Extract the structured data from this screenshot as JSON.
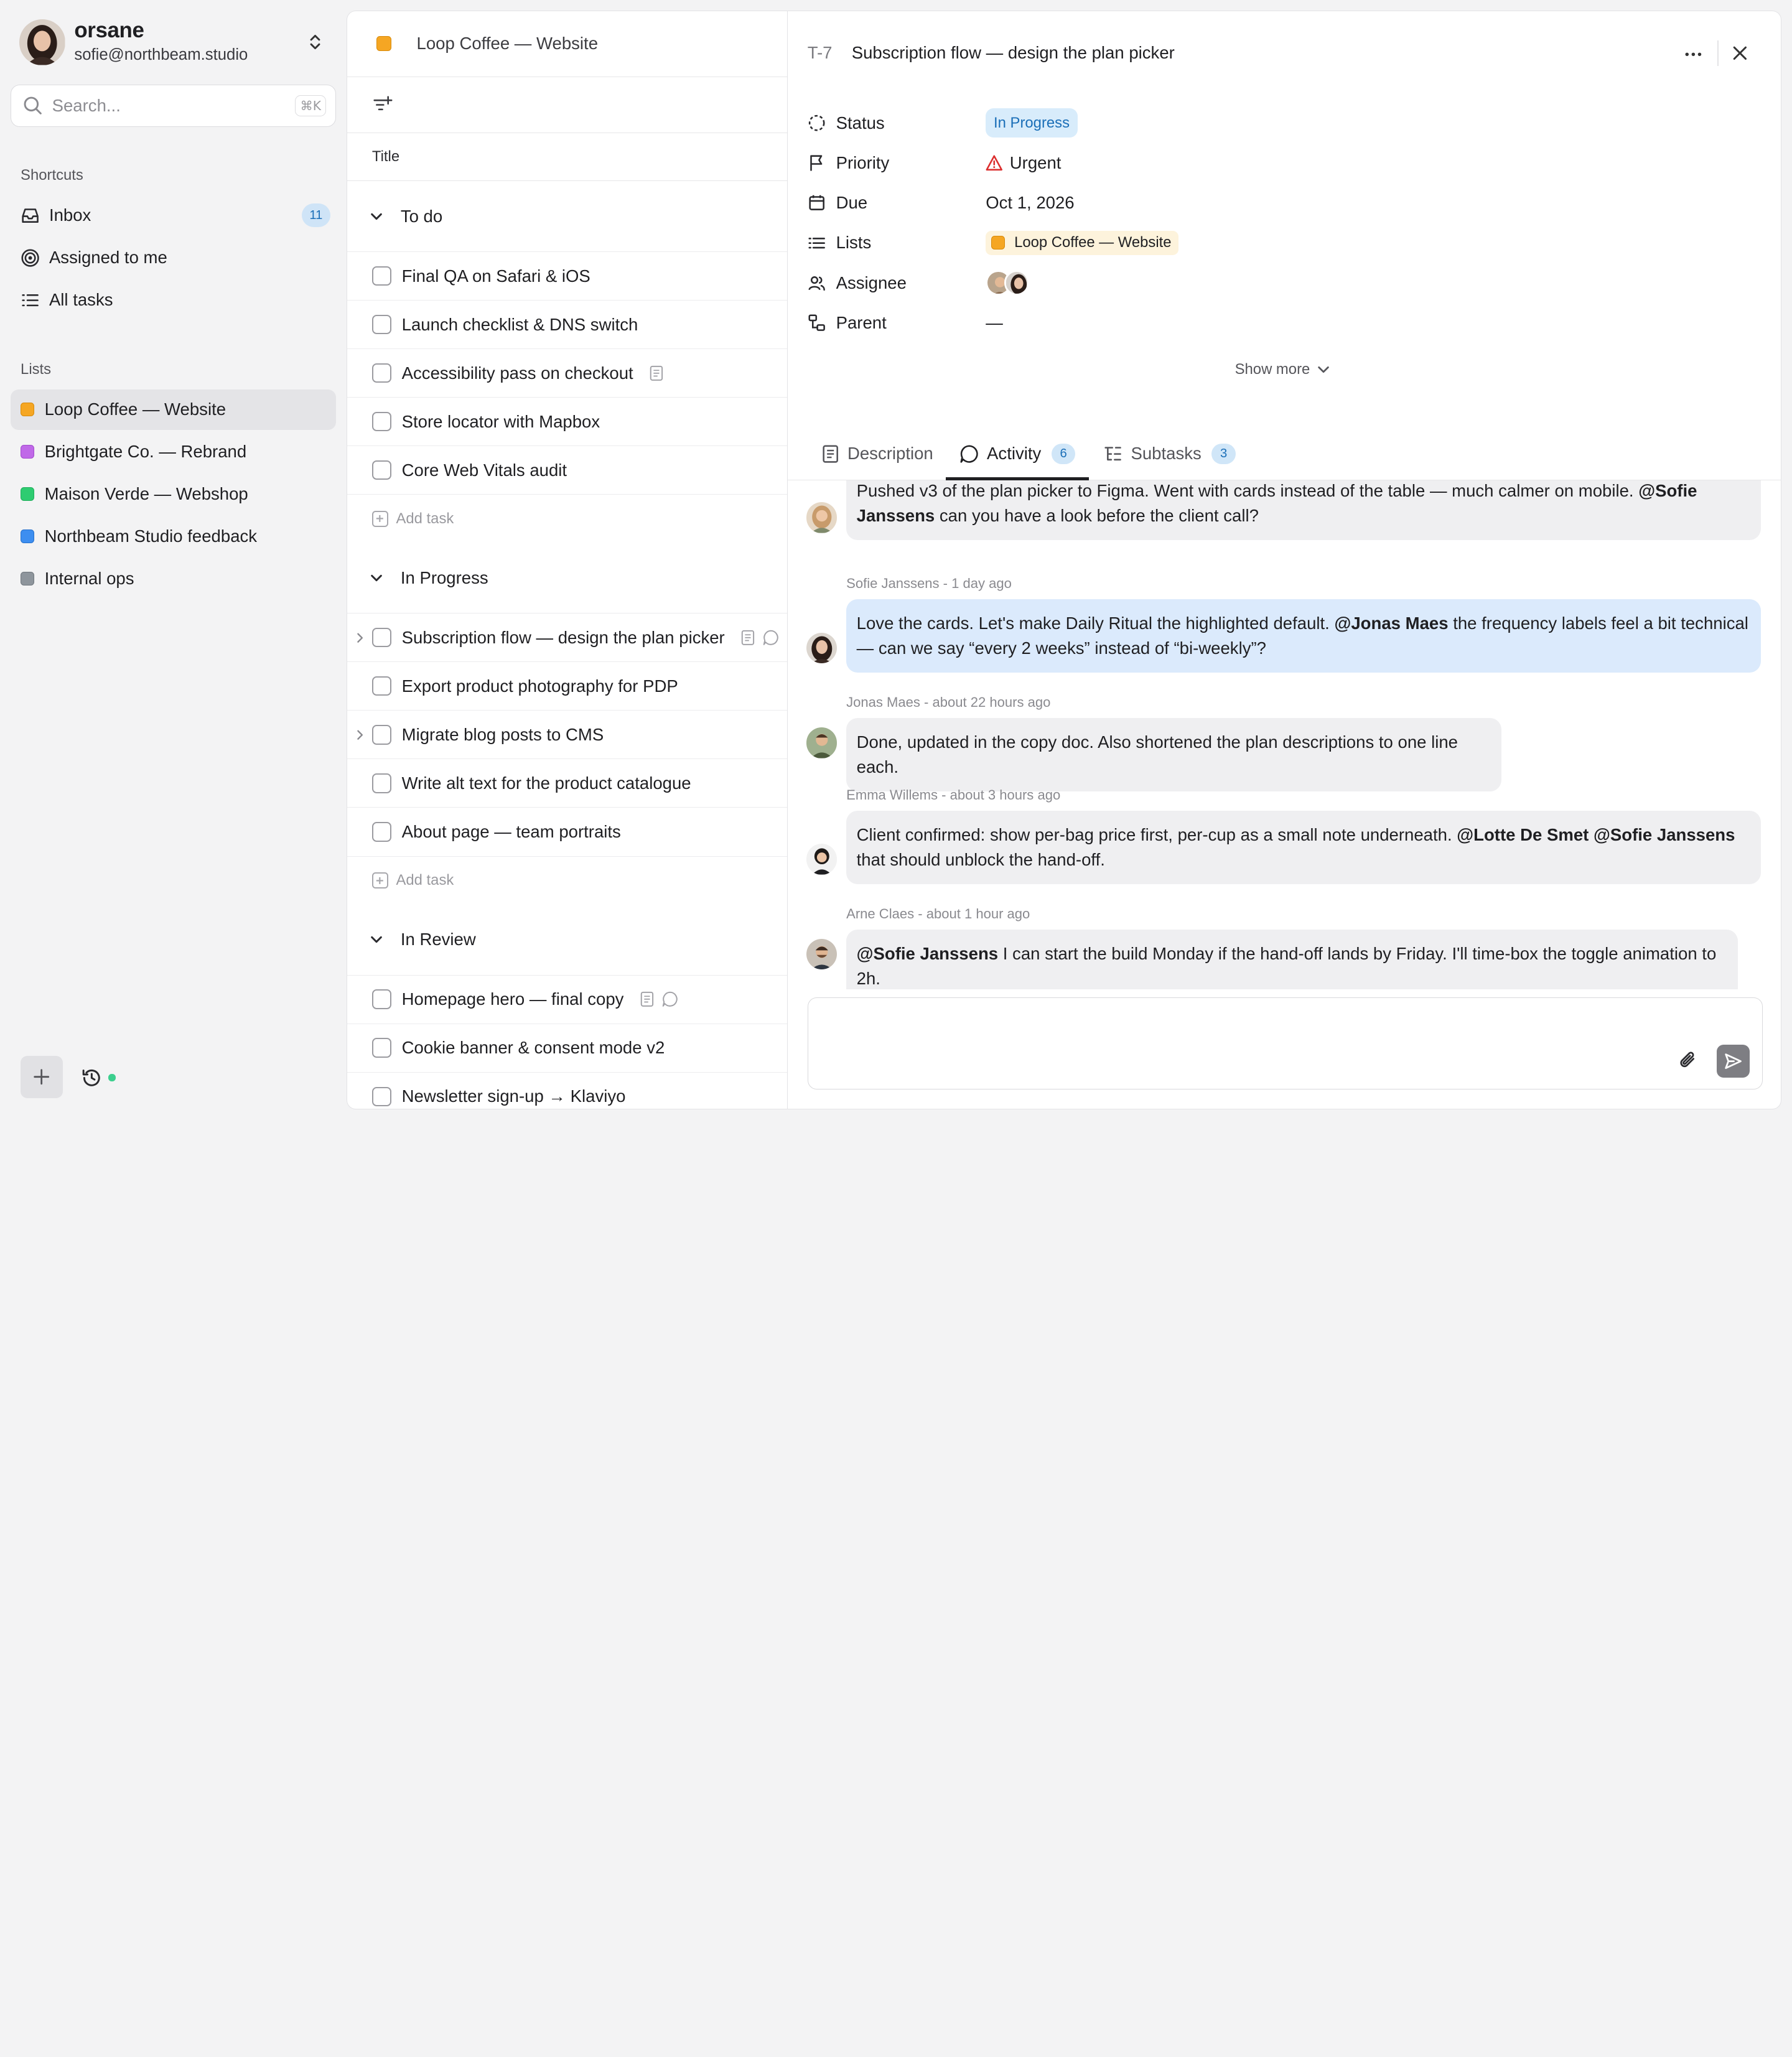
{
  "account": {
    "name": "orsane",
    "email": "sofie@northbeam.studio"
  },
  "search": {
    "placeholder": "Search...",
    "shortcut": "⌘K"
  },
  "shortcuts": {
    "label": "Shortcuts",
    "items": [
      {
        "label": "Inbox",
        "count": "11",
        "icon": "inbox-icon"
      },
      {
        "label": "Assigned to me",
        "icon": "target-icon"
      },
      {
        "label": "All tasks",
        "icon": "list-icon"
      }
    ]
  },
  "lists": {
    "label": "Lists",
    "items": [
      {
        "label": "Loop Coffee — Website",
        "color": "#f5a623",
        "active": true
      },
      {
        "label": "Brightgate Co. — Rebrand",
        "color": "#c069e8"
      },
      {
        "label": "Maison Verde — Webshop",
        "color": "#2ecc71"
      },
      {
        "label": "Northbeam Studio feedback",
        "color": "#3d8ef0"
      },
      {
        "label": "Internal ops",
        "color": "#8e959c"
      }
    ]
  },
  "listpanel": {
    "title": "Loop Coffee — Website",
    "column_title": "Title",
    "add_task": "Add task",
    "groups": [
      {
        "name": "To do",
        "tasks": [
          {
            "title": "Final QA on Safari & iOS"
          },
          {
            "title": "Launch checklist & DNS switch"
          },
          {
            "title": "Accessibility pass on checkout",
            "doc": true
          },
          {
            "title": "Store locator with Mapbox"
          },
          {
            "title": "Core Web Vitals audit"
          }
        ]
      },
      {
        "name": "In Progress",
        "tasks": [
          {
            "title": "Subscription flow — design the plan picker",
            "doc": true,
            "comment": true,
            "expandable": true
          },
          {
            "title": "Export product photography for PDP"
          },
          {
            "title": "Migrate blog posts to CMS",
            "expandable": true
          },
          {
            "title": "Write alt text for the product catalogue"
          },
          {
            "title": "About page — team portraits"
          }
        ]
      },
      {
        "name": "In Review",
        "tasks": [
          {
            "title": "Homepage hero — final copy",
            "doc": true,
            "comment": true
          },
          {
            "title": "Cookie banner & consent mode v2"
          },
          {
            "title": "Newsletter sign-up → Klaviyo"
          }
        ]
      }
    ]
  },
  "detail": {
    "key": "T-7",
    "title": "Subscription flow — design the plan picker",
    "properties": {
      "status_label": "Status",
      "status_value": "In Progress",
      "priority_label": "Priority",
      "priority_value": "Urgent",
      "due_label": "Due",
      "due_value": "Oct 1, 2026",
      "lists_label": "Lists",
      "lists_value": "Loop Coffee — Website",
      "assignee_label": "Assignee",
      "parent_label": "Parent",
      "parent_value": "—"
    },
    "show_more": "Show more",
    "tabs": {
      "description": "Description",
      "activity": "Activity",
      "activity_count": "6",
      "subtasks": "Subtasks",
      "subtasks_count": "3"
    },
    "comments": [
      {
        "meta": "",
        "parts": [
          {
            "t": "Pushed v3 of the plan picker to Figma. Went with cards instead of the table — much calmer on mobile. "
          },
          {
            "t": "@Sofie Janssens",
            "b": true
          },
          {
            "t": " can you have a look before the client call?"
          }
        ]
      },
      {
        "meta": "Sofie Janssens - 1 day ago",
        "mine": true,
        "parts": [
          {
            "t": "Love the cards. Let's make Daily Ritual the highlighted default. "
          },
          {
            "t": "@Jonas Maes",
            "b": true
          },
          {
            "t": " the frequency labels feel a bit technical — can we say “every 2 weeks” instead of “bi-weekly”?"
          }
        ]
      },
      {
        "meta": "Jonas Maes - about 22 hours ago",
        "parts": [
          {
            "t": "Done, updated in the copy doc. Also shortened the plan descriptions to one line each."
          }
        ]
      },
      {
        "meta": "Emma Willems - about 3 hours ago",
        "parts": [
          {
            "t": "Client confirmed: show per-bag price first, per-cup as a small note underneath. "
          },
          {
            "t": "@Lotte De Smet",
            "b": true
          },
          {
            "t": " "
          },
          {
            "t": "@Sofie Janssens",
            "b": true
          },
          {
            "t": " that should unblock the hand-off."
          }
        ]
      },
      {
        "meta": "Arne Claes - about 1 hour ago",
        "parts": [
          {
            "t": "@Sofie Janssens",
            "b": true
          },
          {
            "t": " I can start the build Monday if the hand-off lands by Friday. I'll time-box the toggle animation to 2h."
          }
        ]
      }
    ],
    "composer_placeholder": ""
  }
}
